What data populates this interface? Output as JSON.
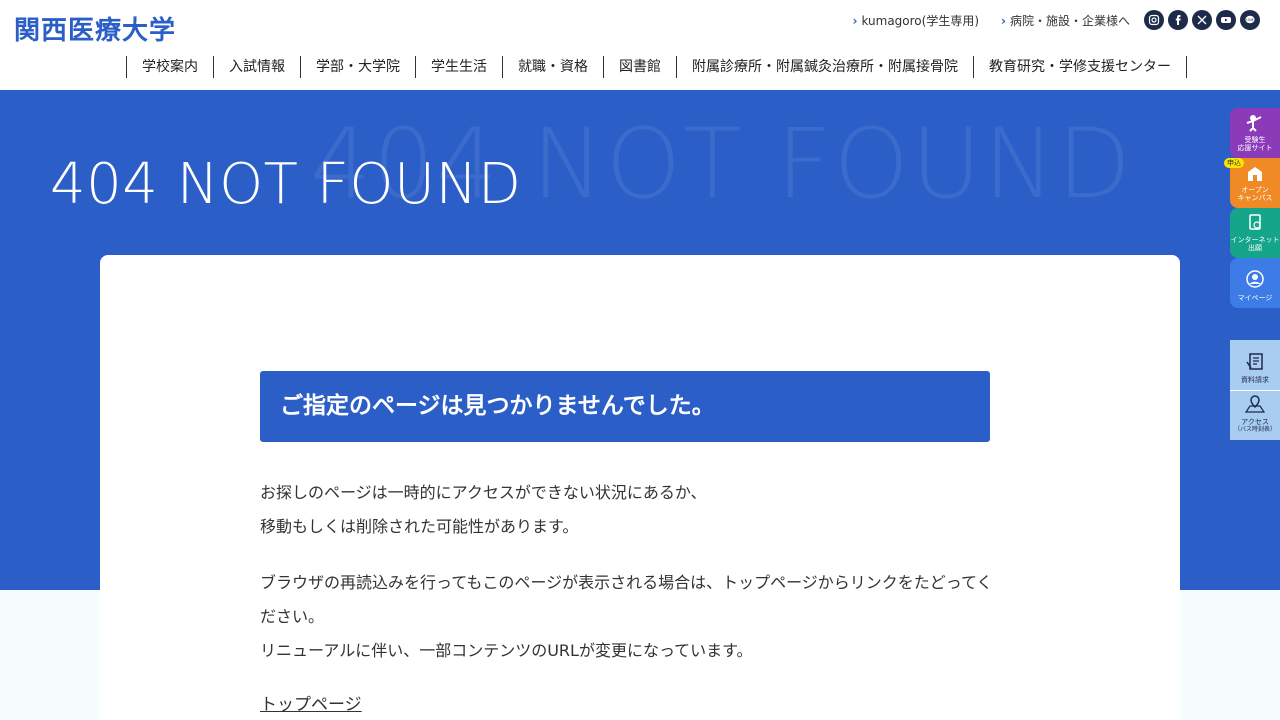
{
  "header": {
    "logo": "関西医療大学",
    "util_links": [
      "kumagoro(学生専用)",
      "病院・施設・企業様へ"
    ],
    "social": [
      "instagram-icon",
      "facebook-icon",
      "x-icon",
      "youtube-icon",
      "line-icon"
    ],
    "social_labels": {
      "line": "LINE"
    }
  },
  "nav": [
    "学校案内",
    "入試情報",
    "学部・大学院",
    "学生生活",
    "就職・資格",
    "図書館",
    "附属診療所・附属鍼灸治療所・附属接骨院",
    "教育研究・学修支援センター"
  ],
  "hero": {
    "title": "404 NOT FOUND",
    "watermark": "404 NOT FOUND"
  },
  "content": {
    "notice": "ご指定のページは見つかりませんでした。",
    "para1_line1": "お探しのページは一時的にアクセスができない状況にあるか、",
    "para1_line2": "移動もしくは削除された可能性があります。",
    "para2_line1": "ブラウザの再読込みを行ってもこのページが表示される場合は、トップページからリンクをたどってください。",
    "para2_line2": "リニューアルに伴い、一部コンテンツのURLが変更になっています。",
    "top_link": "トップページ"
  },
  "side_tabs": {
    "exam": {
      "l1": "受験生",
      "l2": "応援サイト"
    },
    "open": {
      "badge": "申込",
      "l1": "オープン",
      "l2": "キャンパス"
    },
    "net": {
      "l1": "インターネット",
      "l2": "出願"
    },
    "mypage": {
      "l1": "マイページ"
    },
    "docs": {
      "l1": "資料請求"
    },
    "access": {
      "l1": "アクセス",
      "l2": "（バス時刻表）"
    }
  },
  "colors": {
    "brand": "#2b5fc7",
    "purple": "#8b3ab8",
    "orange": "#f08a24",
    "green": "#14a58a",
    "blue": "#3d7be6",
    "light_blue": "#a9cdf0"
  }
}
